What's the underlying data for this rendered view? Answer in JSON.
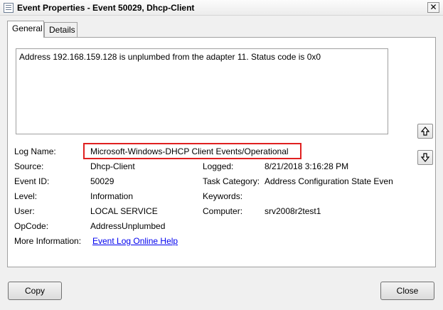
{
  "window": {
    "title": "Event Properties - Event 50029, Dhcp-Client",
    "close_glyph": "✕"
  },
  "tabs": [
    {
      "label": "General",
      "selected": true
    },
    {
      "label": "Details",
      "selected": false
    }
  ],
  "description": "Address 192.168.159.128 is unplumbed from  the adapter 11. Status code is 0x0",
  "fields": {
    "log_name": {
      "label": "Log Name:",
      "value": "Microsoft-Windows-DHCP Client Events/Operational"
    },
    "source": {
      "label": "Source:",
      "value": "Dhcp-Client"
    },
    "logged": {
      "label": "Logged:",
      "value": "8/21/2018 3:16:28 PM"
    },
    "event_id": {
      "label": "Event ID:",
      "value": "50029"
    },
    "task_category": {
      "label": "Task Category:",
      "value": "Address Configuration State Event"
    },
    "level": {
      "label": "Level:",
      "value": "Information"
    },
    "keywords": {
      "label": "Keywords:",
      "value": ""
    },
    "user": {
      "label": "User:",
      "value": "LOCAL SERVICE"
    },
    "computer": {
      "label": "Computer:",
      "value": "srv2008r2test1"
    },
    "opcode": {
      "label": "OpCode:",
      "value": "AddressUnplumbed"
    },
    "more_info": {
      "label": "More Information:",
      "value": "Event Log Online Help"
    }
  },
  "buttons": {
    "copy": "Copy",
    "close": "Close"
  },
  "colors": {
    "highlight": "#e02020",
    "link": "#0000ee"
  },
  "icons": {
    "up": "arrow-up-icon",
    "down": "arrow-down-icon"
  }
}
